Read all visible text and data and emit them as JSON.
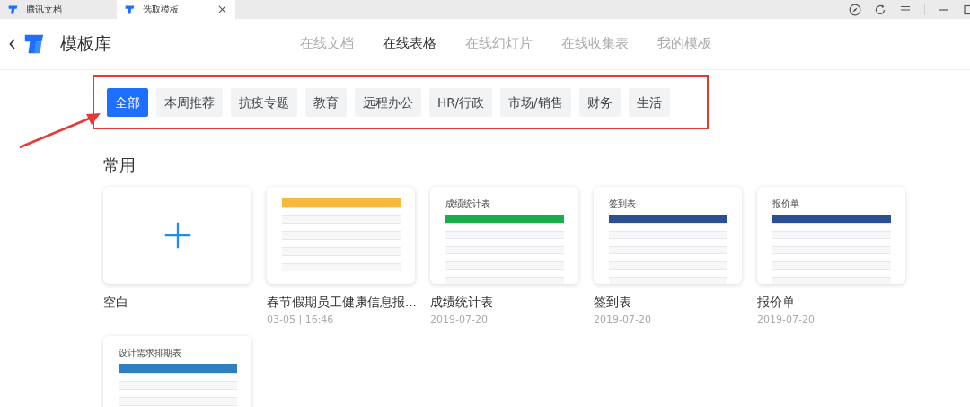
{
  "browser_tabs": [
    {
      "label": "腾讯文档",
      "selected": false
    },
    {
      "label": "选取模板",
      "selected": true
    }
  ],
  "header": {
    "title": "模板库"
  },
  "nav_tabs": [
    {
      "label": "在线文档",
      "selected": false
    },
    {
      "label": "在线表格",
      "selected": true
    },
    {
      "label": "在线幻灯片",
      "selected": false
    },
    {
      "label": "在线收集表",
      "selected": false
    },
    {
      "label": "我的模板",
      "selected": false
    }
  ],
  "categories": [
    {
      "label": "全部",
      "selected": true
    },
    {
      "label": "本周推荐",
      "selected": false
    },
    {
      "label": "抗疫专题",
      "selected": false
    },
    {
      "label": "教育",
      "selected": false
    },
    {
      "label": "远程办公",
      "selected": false
    },
    {
      "label": "HR/行政",
      "selected": false
    },
    {
      "label": "市场/销售",
      "selected": false
    },
    {
      "label": "财务",
      "selected": false
    },
    {
      "label": "生活",
      "selected": false
    }
  ],
  "section": {
    "title": "常用"
  },
  "templates": [
    {
      "kind": "blank",
      "name": "空白"
    },
    {
      "kind": "sheet",
      "name": "春节假期员工健康信息报...",
      "date": "03-05 | 16:46",
      "color": "#f6b93b"
    },
    {
      "kind": "sheet",
      "name": "成绩统计表",
      "date": "2019-07-20",
      "preview_title": "成绩统计表",
      "color": "#1aad4b"
    },
    {
      "kind": "sheet",
      "name": "签到表",
      "date": "2019-07-20",
      "preview_title": "签到表",
      "color": "#2b4f8f"
    },
    {
      "kind": "sheet",
      "name": "报价单",
      "date": "2019-07-20",
      "preview_title": "报价单",
      "color": "#2a4f93"
    },
    {
      "kind": "sheet",
      "preview_title": "设计需求排期表",
      "color": "#2f7fc1"
    }
  ]
}
